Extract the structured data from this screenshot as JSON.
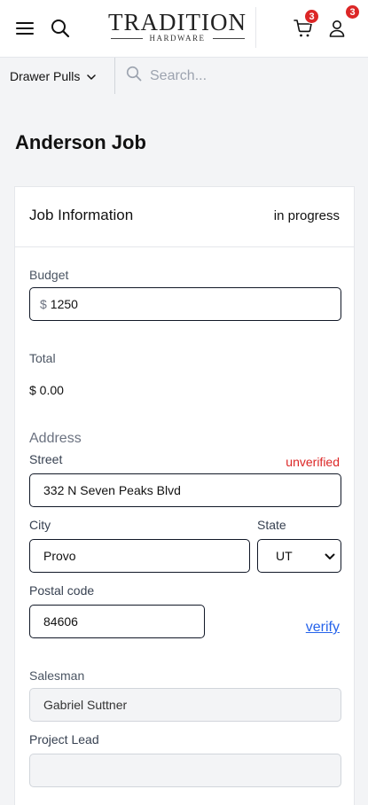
{
  "header": {
    "logo_main": "TRADITION",
    "logo_sub": "HARDWARE",
    "cart_count": "3",
    "user_count": "3",
    "icons": [
      "menu-icon",
      "search-icon",
      "cart-icon",
      "user-icon"
    ]
  },
  "subbar": {
    "category_label": "Drawer Pulls",
    "search_placeholder": "Search..."
  },
  "page": {
    "title": "Anderson Job"
  },
  "job": {
    "section_title": "Job Information",
    "status": "in progress",
    "budget_label": "Budget",
    "budget_currency": "$",
    "budget_value": "1250",
    "total_label": "Total",
    "total_value": "$ 0.00",
    "address_heading": "Address",
    "street_label": "Street",
    "street_status": "unverified",
    "street_value": "332 N Seven Peaks Blvd",
    "city_label": "City",
    "city_value": "Provo",
    "state_label": "State",
    "state_value": "UT",
    "postal_label": "Postal code",
    "postal_value": "84606",
    "verify_label": "verify",
    "salesman_label": "Salesman",
    "salesman_value": "Gabriel Suttner",
    "project_lead_label": "Project Lead",
    "project_lead_value": ""
  },
  "colors": {
    "badge": "#dc2626",
    "link": "#2563eb",
    "warning": "#dc2626"
  }
}
